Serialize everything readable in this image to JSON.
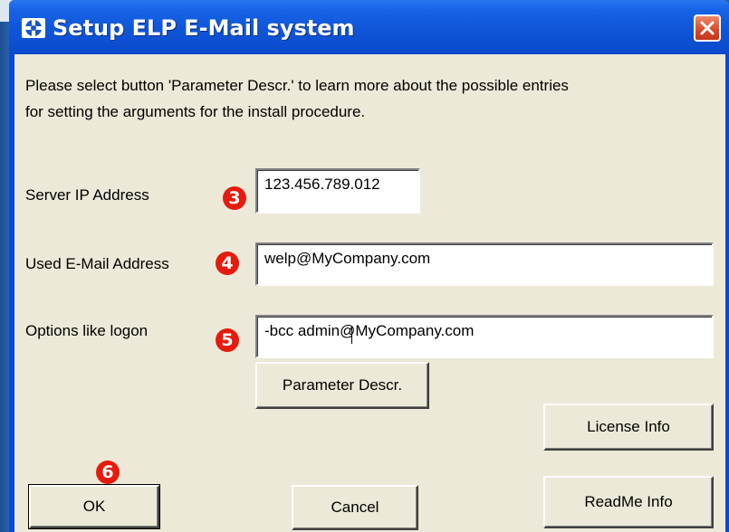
{
  "window": {
    "title": "Setup ELP E-Mail system"
  },
  "description": {
    "line1": "Please select button 'Parameter Descr.' to learn more about the possible entries",
    "line2": "for setting the arguments for the install procedure."
  },
  "fields": {
    "server_ip": {
      "label": "Server IP Address",
      "value": "123.456.789.012",
      "badge": "3"
    },
    "email": {
      "label": "Used E-Mail Address",
      "value": "welp@MyCompany.com",
      "badge": "4"
    },
    "options": {
      "label": "Options like logon",
      "value": "-bcc admin@MyCompany.com",
      "badge": "5"
    }
  },
  "buttons": {
    "parameter_descr": "Parameter Descr.",
    "license_info": "License Info",
    "ok": "OK",
    "ok_badge": "6",
    "cancel": "Cancel",
    "readme_info": "ReadMe Info"
  },
  "colors": {
    "title_bar": "#0b4ad0",
    "client_bg": "#ece9d8",
    "badge": "#e51b0e",
    "close_button": "#d9462a"
  },
  "icons": {
    "title_icon": "app-gear-icon",
    "close": "close-icon"
  }
}
